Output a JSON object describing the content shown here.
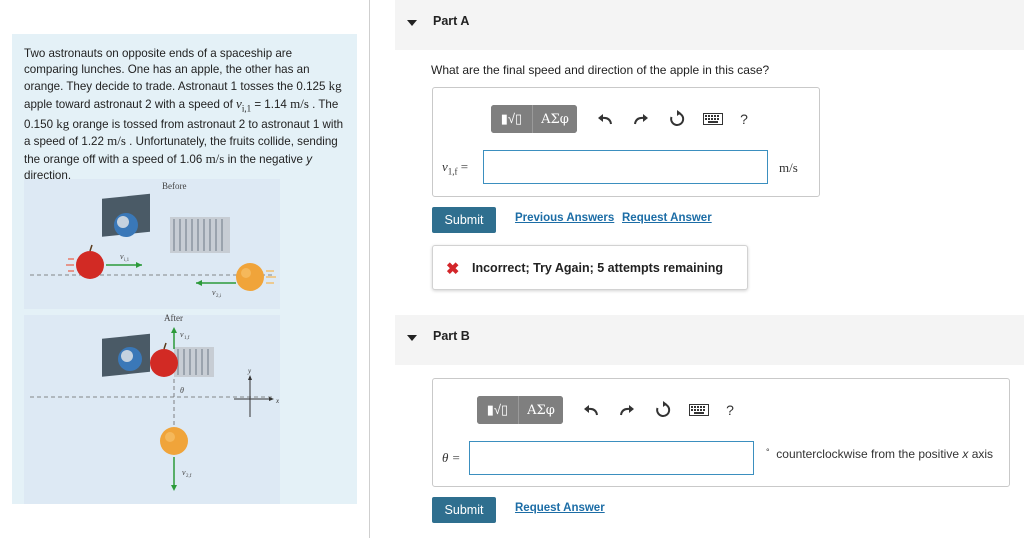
{
  "problem": {
    "t1": "Two astronauts on opposite ends of a spaceship are comparing lunches. One has an apple, the other has an orange. They decide to trade. Astronaut 1 tosses the 0.125 ",
    "u_kg": "kg",
    "t2": " apple toward astronaut 2 with a speed of ",
    "v_i1": "v",
    "v_i1_sub": "i,1",
    "t3": " = 1.14 ",
    "u_ms": "m/s",
    "t4": " . The 0.150 ",
    "t5": " orange is tossed from astronaut 2 to astronaut 1 with a speed of 1.22 ",
    "t6": " . Unfortunately, the fruits collide, sending the orange off with a speed of 1.06 ",
    "t7": " in the negative ",
    "t_y": "y",
    "t8": " direction."
  },
  "figure": {
    "before_label": "Before",
    "after_label": "After",
    "v_i1": "v",
    "v_i1_sub": "i,1",
    "v_2i": "v",
    "v_2i_sub": "2,i",
    "v_1f": "v",
    "v_1f_sub": "1,f",
    "theta": "θ",
    "v_2f": "v",
    "v_2f_sub": "2,f",
    "axis_x": "x",
    "axis_y": "y"
  },
  "partA": {
    "title": "Part A",
    "question": "What are the final speed and direction of the apple in this case?",
    "toolbar": {
      "frac": "▮√▯",
      "greek": "ΑΣφ",
      "help": "?"
    },
    "var": "v",
    "var_sub": "1,f",
    "eq": " =",
    "input_value": "",
    "unit": "m/s",
    "submit": "Submit",
    "previous_answers": "Previous Answers",
    "request_answer": "Request Answer",
    "feedback_icon": "✖",
    "feedback": "Incorrect; Try Again; 5 attempts remaining"
  },
  "partB": {
    "title": "Part B",
    "toolbar": {
      "frac": "▮√▯",
      "greek": "ΑΣφ",
      "help": "?"
    },
    "var": "θ =",
    "input_value": "",
    "unit_deg": "°",
    "unit_text_1": "counterclockwise from the positive ",
    "unit_x": "x",
    "unit_text_2": " axis",
    "submit": "Submit",
    "request_answer": "Request Answer"
  }
}
